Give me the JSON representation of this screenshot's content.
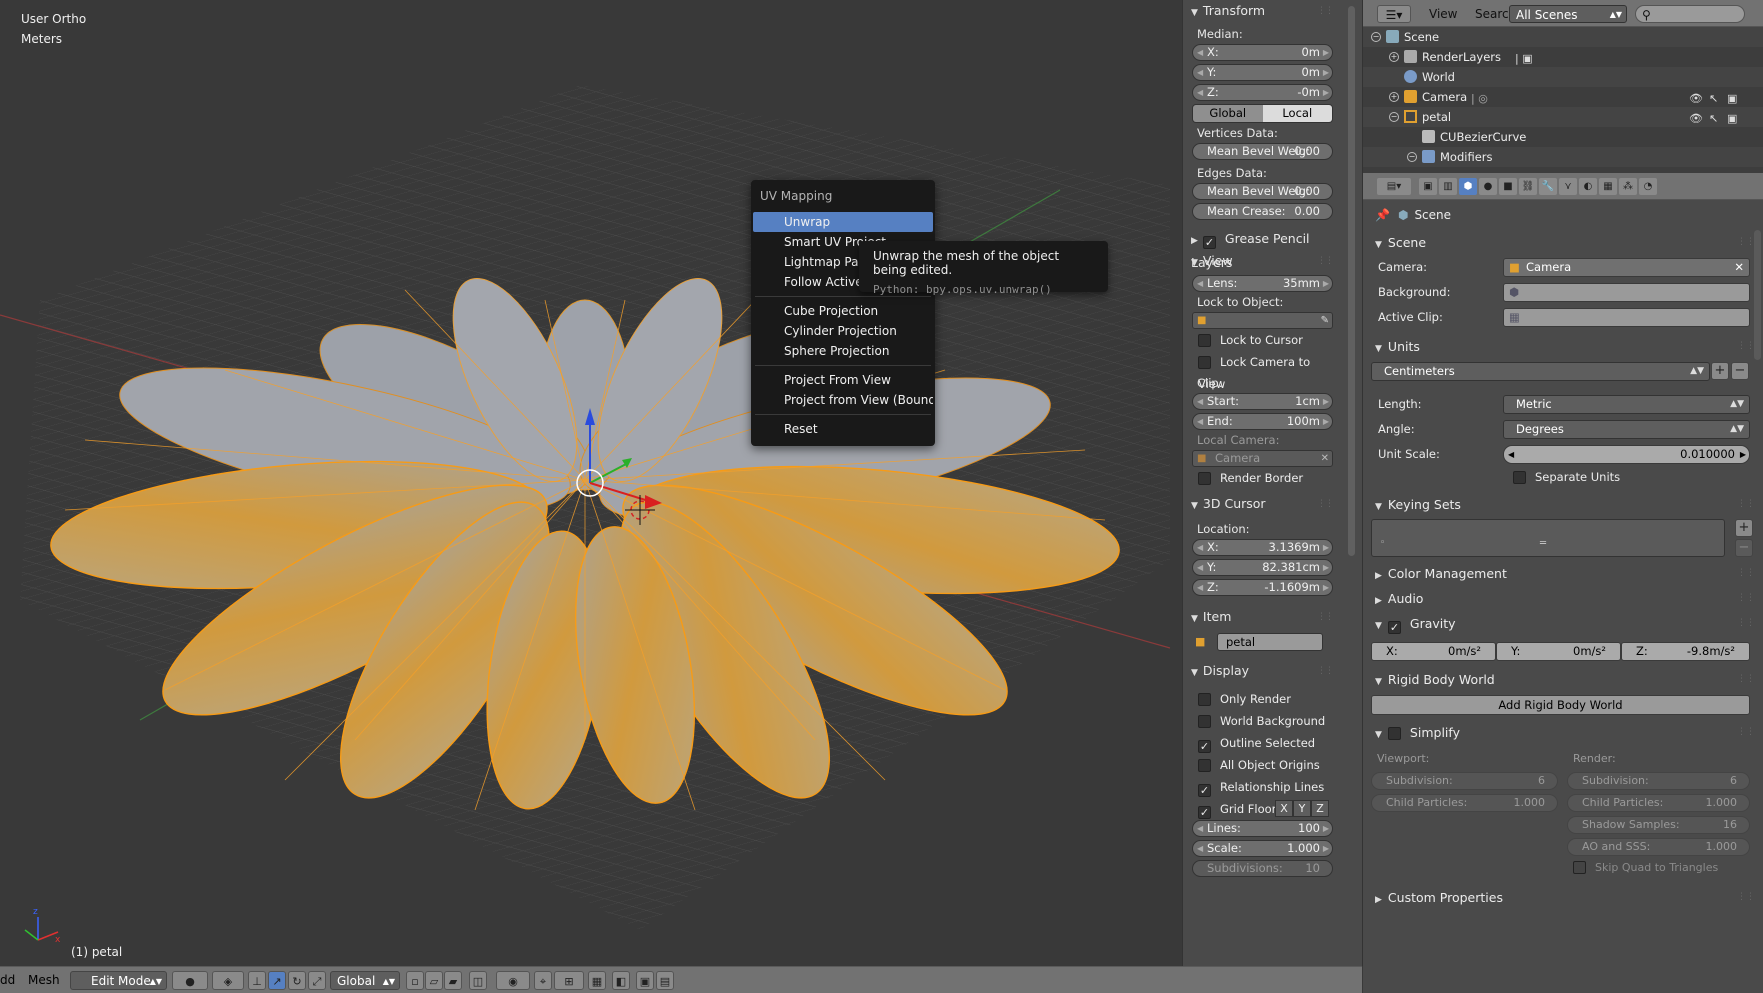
{
  "viewport": {
    "view_label": "User Ortho",
    "units_label": "Meters",
    "object_label": "(1) petal"
  },
  "uv_menu": {
    "title": "UV Mapping",
    "items": [
      {
        "label": "Unwrap",
        "active": true
      },
      {
        "label": "Smart UV Project"
      },
      {
        "label": "Lightmap Pack"
      },
      {
        "label": "Follow Active Quads"
      },
      {
        "sep": true
      },
      {
        "label": "Cube Projection"
      },
      {
        "label": "Cylinder Projection"
      },
      {
        "label": "Sphere Projection"
      },
      {
        "sep": true
      },
      {
        "label": "Project From View"
      },
      {
        "label": "Project from View (Bounds)"
      },
      {
        "sep": true
      },
      {
        "label": "Reset"
      }
    ],
    "tooltip_text": "Unwrap the mesh of the object being edited.",
    "tooltip_python": "Python: bpy.ops.uv.unwrap()"
  },
  "bottom_bar": {
    "view_menu": "dd",
    "mesh_menu": "Mesh",
    "mode": "Edit Mode",
    "orientation": "Global"
  },
  "npanel": {
    "transform": {
      "title": "Transform",
      "median_label": "Median:",
      "x_label": "X:",
      "x": "0m",
      "y_label": "Y:",
      "y": "0m",
      "z_label": "Z:",
      "z": "-0m",
      "global": "Global",
      "local": "Local",
      "vertices_label": "Vertices Data:",
      "mean_bevel_label": "Mean Bevel Weig:",
      "mean_bevel_v": "0.00",
      "edges_label": "Edges Data:",
      "mean_bevel_e_label": "Mean Bevel Weig:",
      "mean_bevel_e": "0.00",
      "mean_crease_label": "Mean Crease:",
      "mean_crease": "0.00"
    },
    "grease_pencil": "Grease Pencil Layers",
    "view": {
      "title": "View",
      "lens_label": "Lens:",
      "lens": "35mm",
      "lock_label": "Lock to Object:",
      "lock_cursor": "Lock to Cursor",
      "lock_camera": "Lock Camera to View",
      "clip_label": "Clip:",
      "start_label": "Start:",
      "start": "1cm",
      "end_label": "End:",
      "end": "100m",
      "local_camera_label": "Local Camera:",
      "local_camera": "Camera",
      "render_border": "Render Border"
    },
    "cursor": {
      "title": "3D Cursor",
      "location_label": "Location:",
      "x_label": "X:",
      "x": "3.1369m",
      "y_label": "Y:",
      "y": "82.381cm",
      "z_label": "Z:",
      "z": "-1.1609m"
    },
    "item": {
      "title": "Item",
      "name": "petal"
    },
    "display": {
      "title": "Display",
      "only_render": "Only Render",
      "world_background": "World Background",
      "outline_selected": "Outline Selected",
      "all_object_origins": "All Object Origins",
      "relationship_lines": "Relationship Lines",
      "grid_floor": "Grid Floor",
      "axis_x": "X",
      "axis_y": "Y",
      "axis_z": "Z",
      "lines_label": "Lines:",
      "lines": "100",
      "scale_label": "Scale:",
      "scale": "1.000",
      "subdivisions_label": "Subdivisions:",
      "subdivisions": "10"
    }
  },
  "outliner": {
    "view_menu": "View",
    "search_menu": "Search",
    "scenes": "All Scenes",
    "tree": [
      {
        "label": "Scene",
        "indent": 0
      },
      {
        "label": "RenderLayers",
        "indent": 1
      },
      {
        "label": "World",
        "indent": 1
      },
      {
        "label": "Camera",
        "indent": 1
      },
      {
        "label": "petal",
        "indent": 1
      },
      {
        "label": "CUBezierCurve",
        "indent": 2
      },
      {
        "label": "Modifiers",
        "indent": 2
      }
    ]
  },
  "properties": {
    "breadcrumb": "Scene",
    "scene": {
      "title": "Scene",
      "camera_label": "Camera:",
      "camera": "Camera",
      "background_label": "Background:",
      "active_clip_label": "Active Clip:"
    },
    "units": {
      "title": "Units",
      "preset": "Centimeters",
      "length_label": "Length:",
      "length": "Metric",
      "angle_label": "Angle:",
      "angle": "Degrees",
      "unit_scale_label": "Unit Scale:",
      "unit_scale": "0.010000",
      "separate_units": "Separate Units"
    },
    "keying_sets": "Keying Sets",
    "color_management": "Color Management",
    "audio": "Audio",
    "gravity": {
      "title": "Gravity",
      "x_label": "X:",
      "x": "0m/s²",
      "y_label": "Y:",
      "y": "0m/s²",
      "z_label": "Z:",
      "z": "-9.8m/s²"
    },
    "rigid_body": {
      "title": "Rigid Body World",
      "button": "Add Rigid Body World"
    },
    "simplify": {
      "title": "Simplify",
      "viewport_label": "Viewport:",
      "render_label": "Render:",
      "v_subdiv_label": "Subdivision:",
      "v_subdiv": "6",
      "v_child_label": "Child Particles:",
      "v_child": "1.000",
      "r_subdiv_label": "Subdivision:",
      "r_subdiv": "6",
      "r_child_label": "Child Particles:",
      "r_child": "1.000",
      "shadow_label": "Shadow Samples:",
      "shadow": "16",
      "ao_label": "AO and SSS:",
      "ao": "1.000",
      "skip_quad": "Skip Quad to Triangles"
    },
    "custom_properties": "Custom Properties"
  },
  "colors": {
    "selection_orange": "#f79b16",
    "mesh_gray": "#9aa0aa",
    "menu_highlight": "#5680c2"
  }
}
